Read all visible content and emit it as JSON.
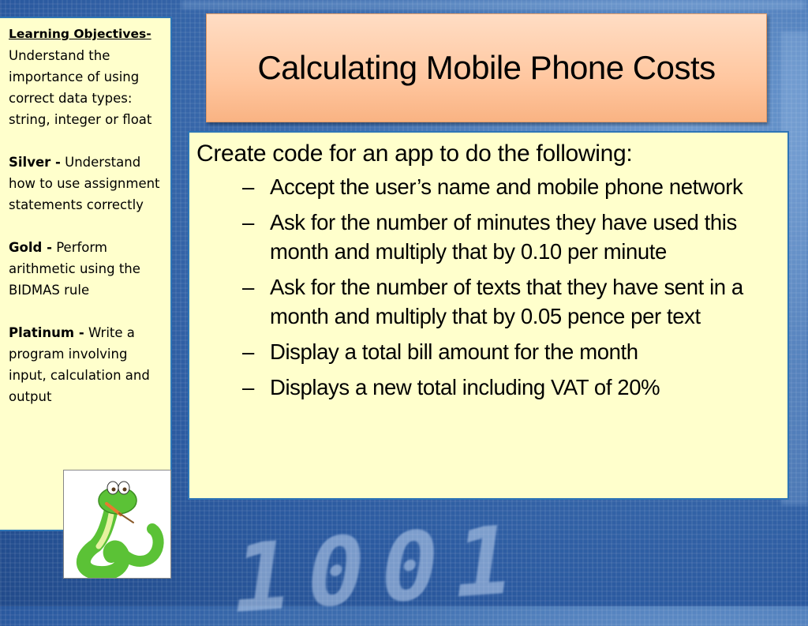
{
  "slide": {
    "title": "Calculating Mobile Phone Costs",
    "background_digits": "1001"
  },
  "objectives": {
    "heading": "Learning Objectives-",
    "intro": "Understand the importance of using correct data types: string, integer or float",
    "levels": [
      {
        "label": "Silver -",
        "text": " Understand how to use assignment statements correctly"
      },
      {
        "label": "Gold -",
        "text": " Perform arithmetic using the BIDMAS rule"
      },
      {
        "label": "Platinum -",
        "text": " Write a program involving input, calculation and output"
      }
    ]
  },
  "task": {
    "intro": "Create code for an app to do the following:",
    "bullet_glyph": "–",
    "items": [
      "Accept the user’s name and mobile phone network",
      "Ask for the number of minutes they have used this month and multiply that by 0.10 per minute",
      "Ask for the number of texts that they have sent in a month and multiply that by 0.05 pence per text",
      "Display a total bill amount for the month",
      "Displays a new total including VAT of 20%"
    ]
  },
  "image": {
    "icon": "python-snake-mascot-icon"
  },
  "colors": {
    "panel_fill": "#FFFFCC",
    "panel_border": "#2E75B6",
    "title_fill": "#FFC7A0",
    "background": "#2B5AA0"
  }
}
